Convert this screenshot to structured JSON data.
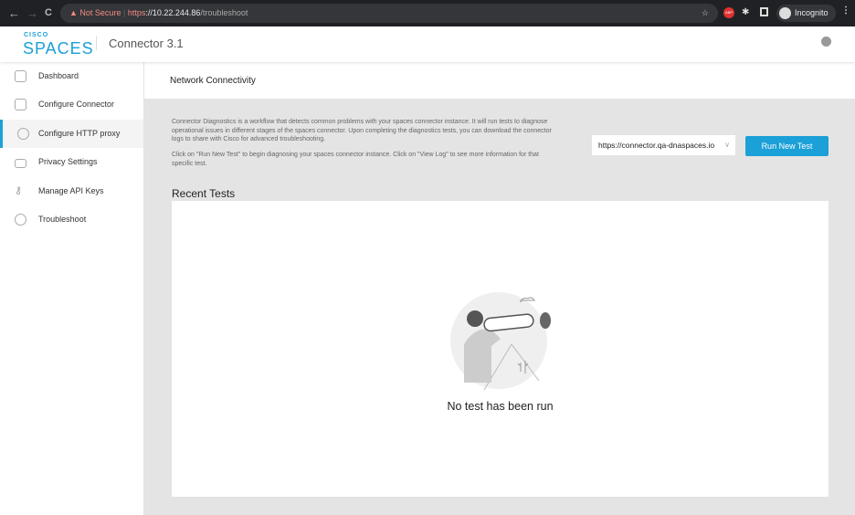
{
  "browser": {
    "back": "←",
    "forward": "→",
    "reload": "C",
    "security": "Not Secure",
    "url_scheme": "https",
    "url_host": "://10.22.244.86",
    "url_path": "/troubleshoot",
    "incognito": "Incognito",
    "abp": "ABP"
  },
  "header": {
    "logo_top": "CISCO",
    "logo_main": "SPACES",
    "title": "Connector 3.1"
  },
  "sidebar": {
    "items": [
      {
        "label": "Dashboard",
        "icon": "dashboard-icon"
      },
      {
        "label": "Configure Connector",
        "icon": "connector-icon"
      },
      {
        "label": "Configure HTTP proxy",
        "icon": "gear-icon",
        "active": true
      },
      {
        "label": "Privacy Settings",
        "icon": "lock-icon"
      },
      {
        "label": "Manage API Keys",
        "icon": "key-icon"
      },
      {
        "label": "Troubleshoot",
        "icon": "pulse-icon"
      }
    ]
  },
  "main": {
    "title": "Network Connectivity",
    "desc1": "Connector Diagnostics is a workflow that detects common problems with your spaces connector instance. It will run tests to diagnose operational issues in different stages of the spaces connector. Upon completing the diagnostics tests, you can download the connector logs to share with Cisco for advanced troubleshooting.",
    "desc2": "Click on \"Run New Test\" to begin diagnosing your spaces connector instance. Click on \"View Log\" to see more information for that specific test.",
    "url_select": "https://connector.qa-dnaspaces.io",
    "run_button": "Run New Test",
    "recent_title": "Recent Tests",
    "empty_text": "No test has been run"
  },
  "colors": {
    "accent": "#1ba0d7",
    "background": "#e4e4e4"
  }
}
